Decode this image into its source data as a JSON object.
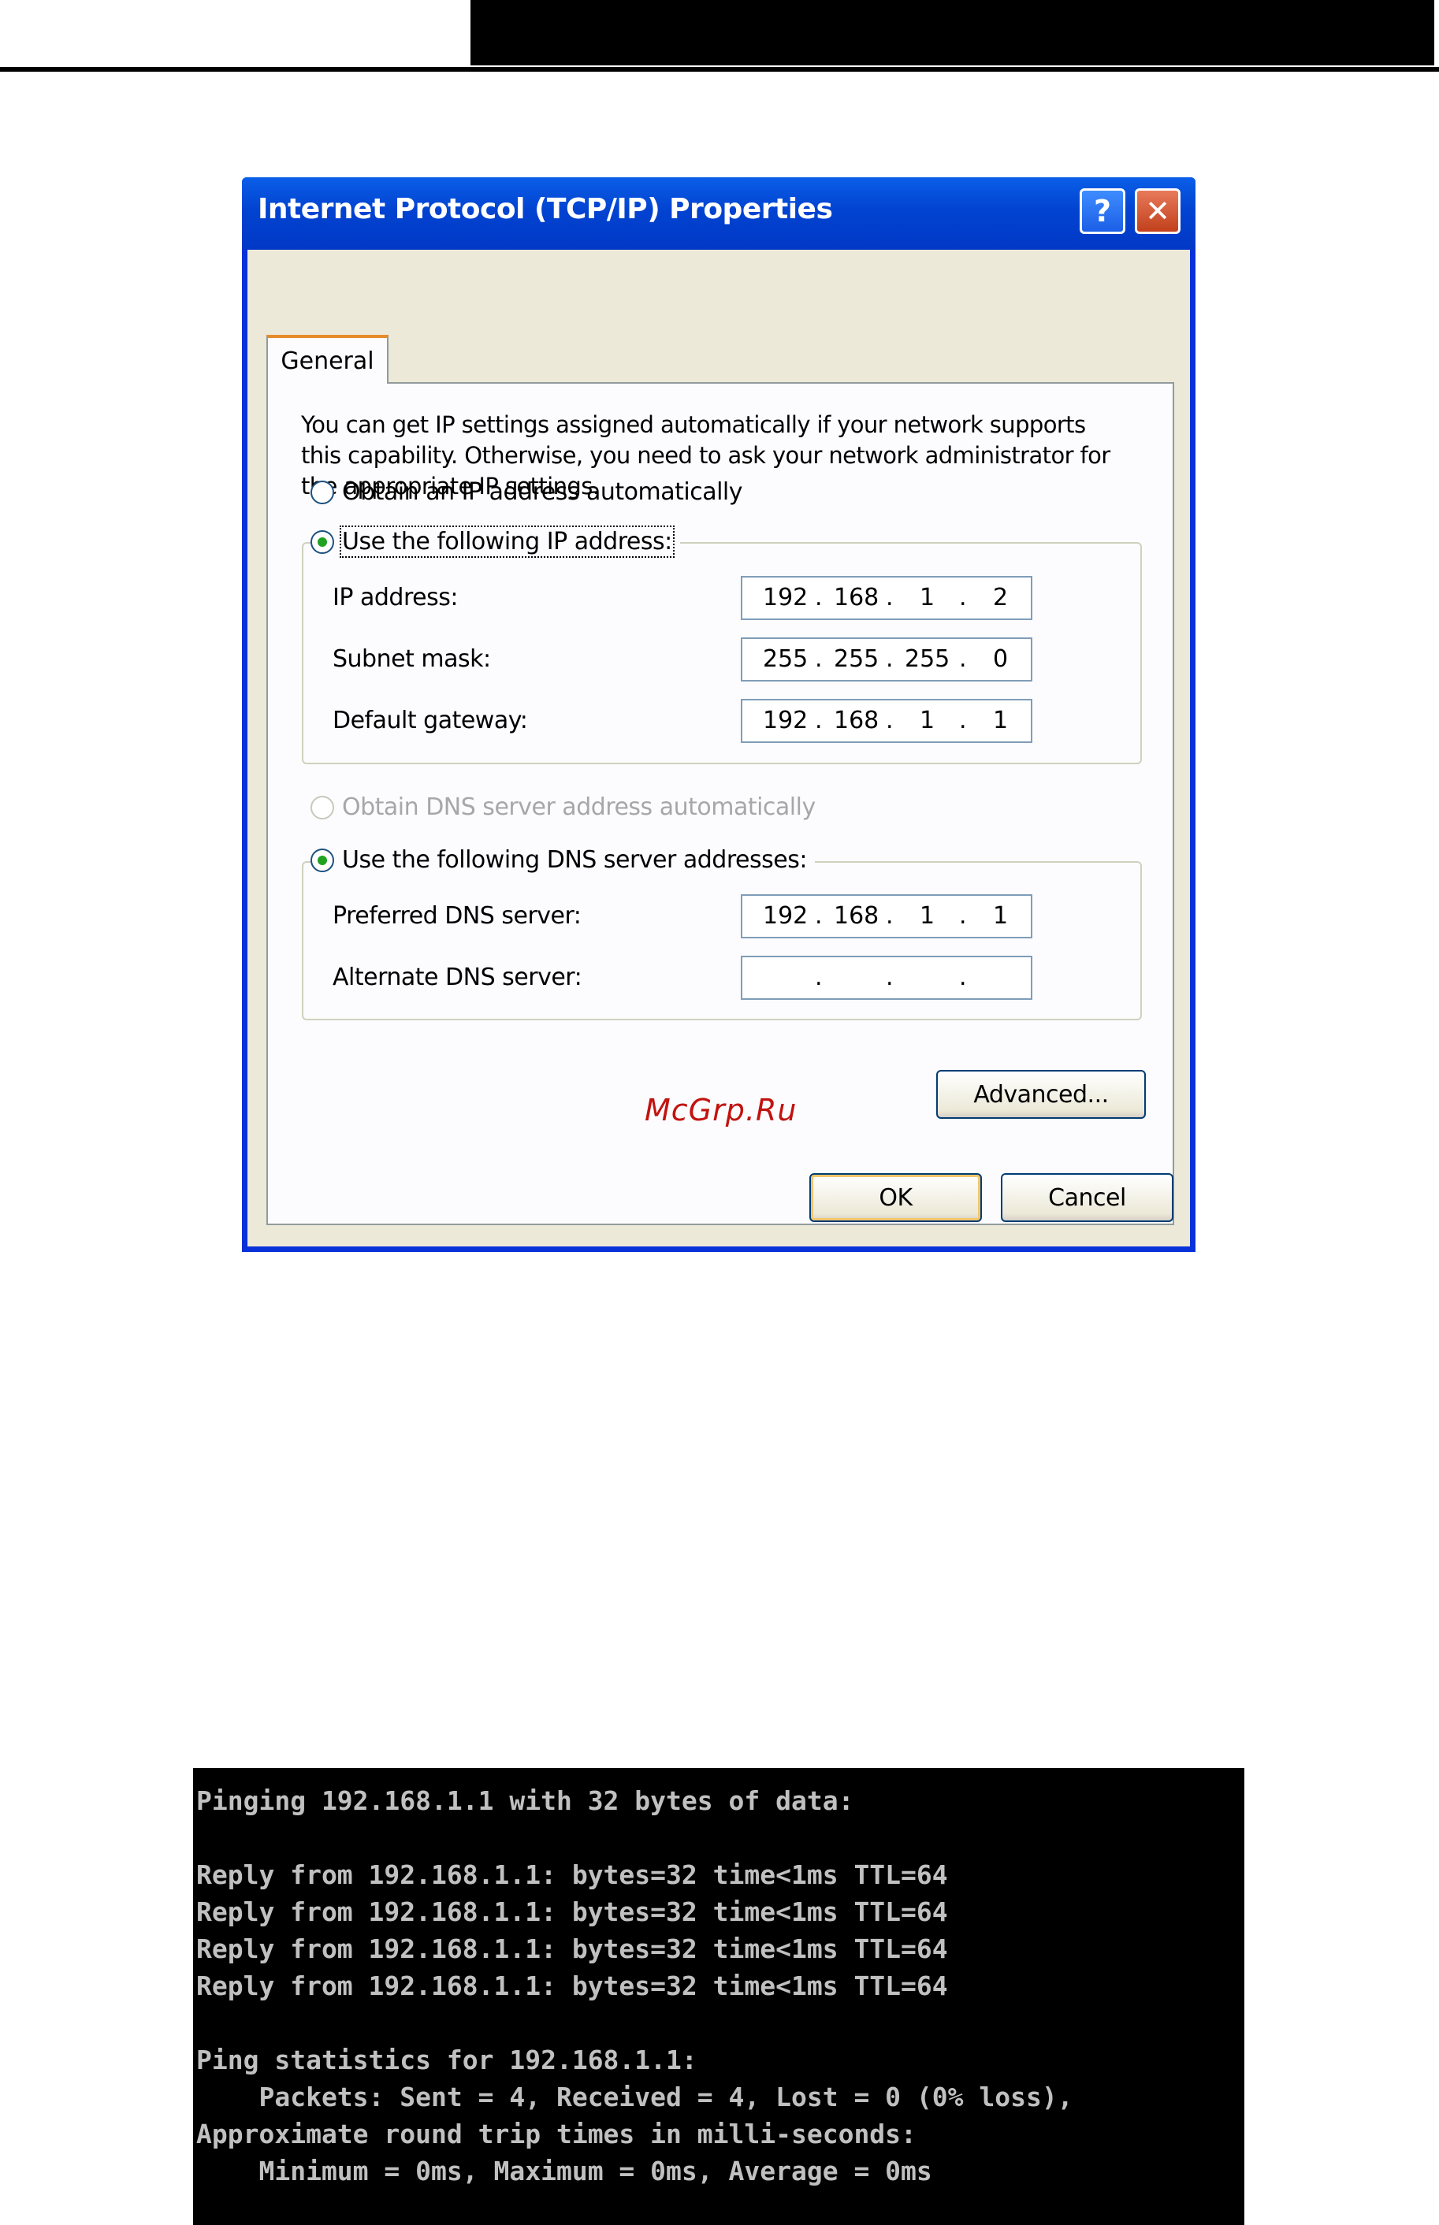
{
  "dialog": {
    "title": "Internet Protocol (TCP/IP) Properties",
    "help_glyph": "?",
    "close_glyph": "✕",
    "tab_label": "General",
    "intro_text": "You can get IP settings assigned automatically if your network supports this capability. Otherwise, you need to ask your network administrator for the appropriate IP settings.",
    "radio_obtain_ip": "Obtain an IP address automatically",
    "radio_use_ip": "Use the following IP address:",
    "ip_label": "IP address:",
    "subnet_label": "Subnet mask:",
    "gateway_label": "Default gateway:",
    "ip_address": [
      "192",
      "168",
      "1",
      "2"
    ],
    "subnet_mask": [
      "255",
      "255",
      "255",
      "0"
    ],
    "default_gateway": [
      "192",
      "168",
      "1",
      "1"
    ],
    "radio_obtain_dns": "Obtain DNS server address automatically",
    "radio_use_dns": "Use the following DNS server addresses:",
    "preferred_dns_label": "Preferred DNS server:",
    "alternate_dns_label": "Alternate DNS server:",
    "preferred_dns": [
      "192",
      "168",
      "1",
      "1"
    ],
    "alternate_dns": [
      "",
      "",
      "",
      ""
    ],
    "advanced_label": "Advanced...",
    "ok_label": "OK",
    "cancel_label": "Cancel",
    "ip_dot": "."
  },
  "watermark": "McGrp.Ru",
  "console": {
    "lines": [
      "Pinging 192.168.1.1 with 32 bytes of data:",
      "",
      "Reply from 192.168.1.1: bytes=32 time<1ms TTL=64",
      "Reply from 192.168.1.1: bytes=32 time<1ms TTL=64",
      "Reply from 192.168.1.1: bytes=32 time<1ms TTL=64",
      "Reply from 192.168.1.1: bytes=32 time<1ms TTL=64",
      "",
      "Ping statistics for 192.168.1.1:",
      "    Packets: Sent = 4, Received = 4, Lost = 0 (0% loss),",
      "Approximate round trip times in milli-seconds:",
      "    Minimum = 0ms, Maximum = 0ms, Average = 0ms"
    ]
  }
}
